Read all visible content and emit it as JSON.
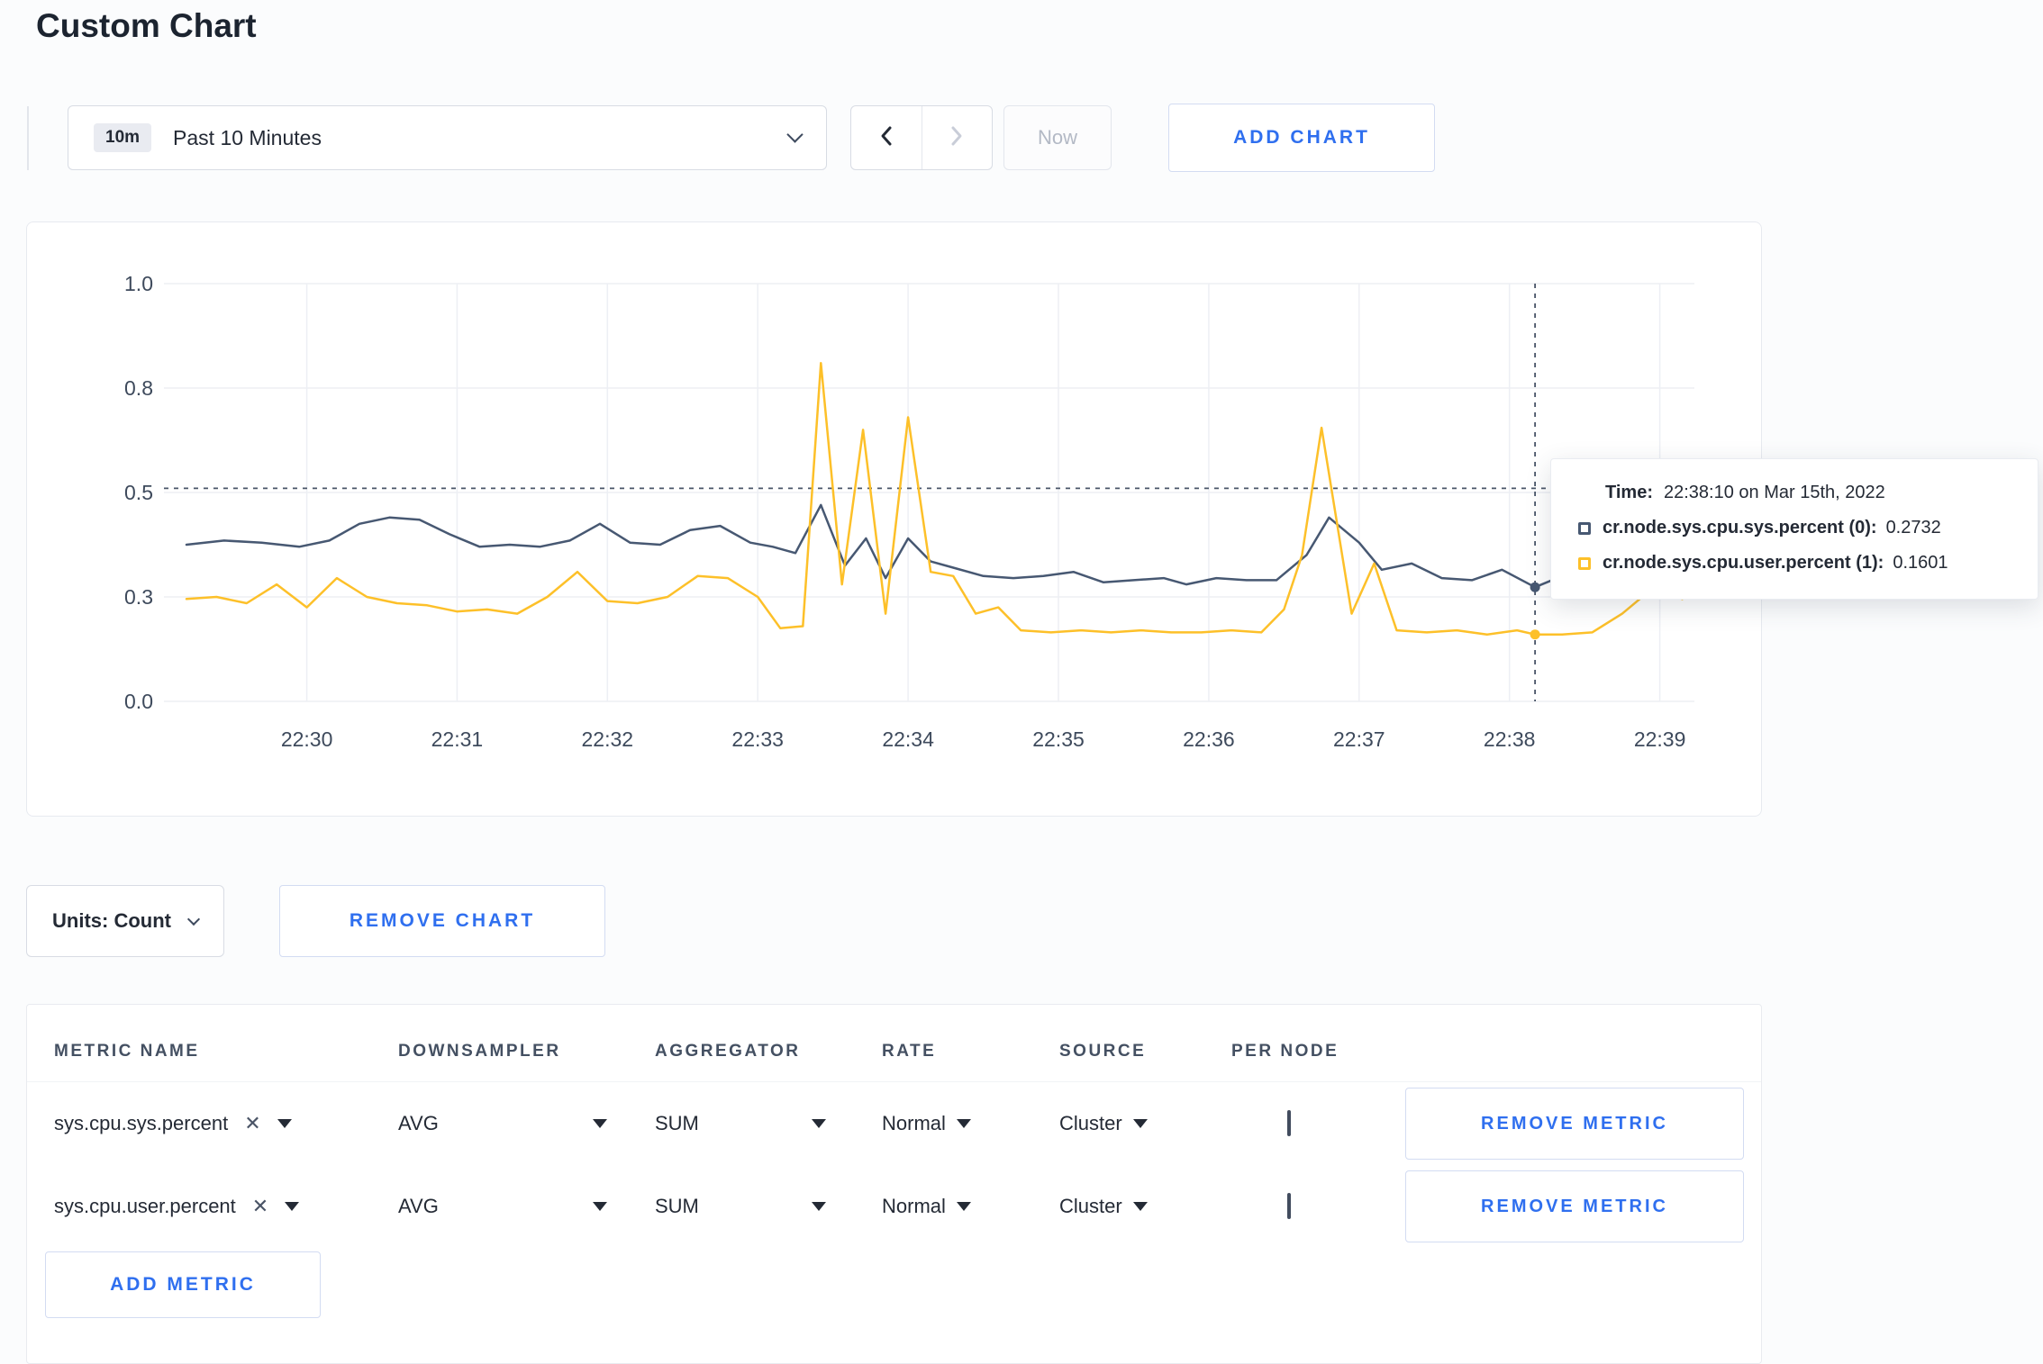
{
  "page": {
    "title": "Custom Chart"
  },
  "toolbar": {
    "time_badge": "10m",
    "time_label": "Past 10 Minutes",
    "now_label": "Now",
    "add_chart_label": "ADD CHART"
  },
  "colors": {
    "accent_blue": "#2f6fef",
    "series_sys": "#475872",
    "series_user": "#fdc029"
  },
  "icons": {
    "clear_metric": "✕"
  },
  "chart_data": {
    "type": "line",
    "title": "",
    "xlabel": "",
    "ylabel": "",
    "xlim": [
      29.05,
      39.23
    ],
    "ylim": [
      0,
      1.0
    ],
    "grid": true,
    "x_ticks": [
      {
        "value": 30,
        "label": "22:30"
      },
      {
        "value": 31,
        "label": "22:31"
      },
      {
        "value": 32,
        "label": "22:32"
      },
      {
        "value": 33,
        "label": "22:33"
      },
      {
        "value": 34,
        "label": "22:34"
      },
      {
        "value": 35,
        "label": "22:35"
      },
      {
        "value": 36,
        "label": "22:36"
      },
      {
        "value": 37,
        "label": "22:37"
      },
      {
        "value": 38,
        "label": "22:38"
      },
      {
        "value": 39,
        "label": "22:39"
      }
    ],
    "y_ticks": [
      {
        "value": 0,
        "label": "0.0"
      },
      {
        "value": 0.25,
        "label": "0.3"
      },
      {
        "value": 0.5,
        "label": "0.5"
      },
      {
        "value": 0.75,
        "label": "0.8"
      },
      {
        "value": 1.0,
        "label": "1.0"
      }
    ],
    "series": [
      {
        "name": "cr.node.sys.cpu.sys.percent",
        "color": "#475872",
        "points": [
          [
            29.2,
            0.375
          ],
          [
            29.45,
            0.385
          ],
          [
            29.7,
            0.38
          ],
          [
            29.95,
            0.37
          ],
          [
            30.15,
            0.385
          ],
          [
            30.35,
            0.425
          ],
          [
            30.55,
            0.44
          ],
          [
            30.75,
            0.435
          ],
          [
            30.95,
            0.4
          ],
          [
            31.15,
            0.37
          ],
          [
            31.35,
            0.375
          ],
          [
            31.55,
            0.37
          ],
          [
            31.75,
            0.385
          ],
          [
            31.95,
            0.425
          ],
          [
            32.15,
            0.38
          ],
          [
            32.35,
            0.375
          ],
          [
            32.55,
            0.41
          ],
          [
            32.75,
            0.42
          ],
          [
            32.95,
            0.38
          ],
          [
            33.1,
            0.37
          ],
          [
            33.25,
            0.355
          ],
          [
            33.42,
            0.47
          ],
          [
            33.58,
            0.325
          ],
          [
            33.72,
            0.39
          ],
          [
            33.85,
            0.295
          ],
          [
            34.0,
            0.39
          ],
          [
            34.15,
            0.335
          ],
          [
            34.3,
            0.32
          ],
          [
            34.5,
            0.3
          ],
          [
            34.7,
            0.295
          ],
          [
            34.9,
            0.3
          ],
          [
            35.1,
            0.31
          ],
          [
            35.3,
            0.285
          ],
          [
            35.5,
            0.29
          ],
          [
            35.7,
            0.295
          ],
          [
            35.85,
            0.28
          ],
          [
            36.05,
            0.295
          ],
          [
            36.25,
            0.29
          ],
          [
            36.45,
            0.29
          ],
          [
            36.65,
            0.35
          ],
          [
            36.8,
            0.44
          ],
          [
            37.0,
            0.38
          ],
          [
            37.15,
            0.315
          ],
          [
            37.35,
            0.33
          ],
          [
            37.55,
            0.295
          ],
          [
            37.75,
            0.29
          ],
          [
            37.95,
            0.315
          ],
          [
            38.17,
            0.2732
          ],
          [
            38.35,
            0.3
          ],
          [
            38.5,
            0.305
          ]
        ]
      },
      {
        "name": "cr.node.sys.cpu.user.percent",
        "color": "#fdc029",
        "points": [
          [
            29.2,
            0.245
          ],
          [
            29.4,
            0.25
          ],
          [
            29.6,
            0.235
          ],
          [
            29.8,
            0.28
          ],
          [
            30.0,
            0.225
          ],
          [
            30.2,
            0.295
          ],
          [
            30.4,
            0.25
          ],
          [
            30.6,
            0.235
          ],
          [
            30.8,
            0.23
          ],
          [
            31.0,
            0.215
          ],
          [
            31.2,
            0.22
          ],
          [
            31.4,
            0.21
          ],
          [
            31.6,
            0.25
          ],
          [
            31.8,
            0.31
          ],
          [
            32.0,
            0.24
          ],
          [
            32.2,
            0.235
          ],
          [
            32.4,
            0.25
          ],
          [
            32.6,
            0.3
          ],
          [
            32.8,
            0.295
          ],
          [
            33.0,
            0.25
          ],
          [
            33.15,
            0.175
          ],
          [
            33.3,
            0.18
          ],
          [
            33.42,
            0.81
          ],
          [
            33.56,
            0.28
          ],
          [
            33.7,
            0.65
          ],
          [
            33.85,
            0.21
          ],
          [
            34.0,
            0.68
          ],
          [
            34.15,
            0.31
          ],
          [
            34.3,
            0.3
          ],
          [
            34.45,
            0.21
          ],
          [
            34.6,
            0.225
          ],
          [
            34.75,
            0.17
          ],
          [
            34.95,
            0.165
          ],
          [
            35.15,
            0.17
          ],
          [
            35.35,
            0.165
          ],
          [
            35.55,
            0.17
          ],
          [
            35.75,
            0.165
          ],
          [
            35.95,
            0.165
          ],
          [
            36.15,
            0.17
          ],
          [
            36.35,
            0.165
          ],
          [
            36.5,
            0.22
          ],
          [
            36.62,
            0.35
          ],
          [
            36.75,
            0.655
          ],
          [
            36.95,
            0.21
          ],
          [
            37.1,
            0.33
          ],
          [
            37.25,
            0.17
          ],
          [
            37.45,
            0.165
          ],
          [
            37.65,
            0.17
          ],
          [
            37.85,
            0.16
          ],
          [
            38.05,
            0.17
          ],
          [
            38.17,
            0.1601
          ],
          [
            38.35,
            0.16
          ],
          [
            38.55,
            0.165
          ],
          [
            38.75,
            0.21
          ],
          [
            38.95,
            0.27
          ],
          [
            39.15,
            0.245
          ]
        ]
      }
    ],
    "crosshair": {
      "x": 38.17,
      "hline": 0.51,
      "markers": [
        0.2732,
        0.1601
      ]
    }
  },
  "tooltip": {
    "time_label": "Time:",
    "time_value": "22:38:10 on Mar 15th, 2022",
    "series": [
      {
        "label": "cr.node.sys.cpu.sys.percent (0):",
        "value": "0.2732",
        "color": "#475872"
      },
      {
        "label": "cr.node.sys.cpu.user.percent (1):",
        "value": "0.1601",
        "color": "#fdc029"
      }
    ]
  },
  "chart_controls": {
    "units_label": "Units: Count",
    "remove_chart_label": "REMOVE CHART"
  },
  "metrics_table": {
    "headers": [
      "METRIC NAME",
      "DOWNSAMPLER",
      "AGGREGATOR",
      "RATE",
      "SOURCE",
      "PER NODE"
    ],
    "rows": [
      {
        "metric": "sys.cpu.sys.percent",
        "downsampler": "AVG",
        "aggregator": "SUM",
        "rate": "Normal",
        "source": "Cluster",
        "per_node": false,
        "remove_label": "REMOVE METRIC"
      },
      {
        "metric": "sys.cpu.user.percent",
        "downsampler": "AVG",
        "aggregator": "SUM",
        "rate": "Normal",
        "source": "Cluster",
        "per_node": false,
        "remove_label": "REMOVE METRIC"
      }
    ],
    "add_metric_label": "ADD METRIC"
  }
}
